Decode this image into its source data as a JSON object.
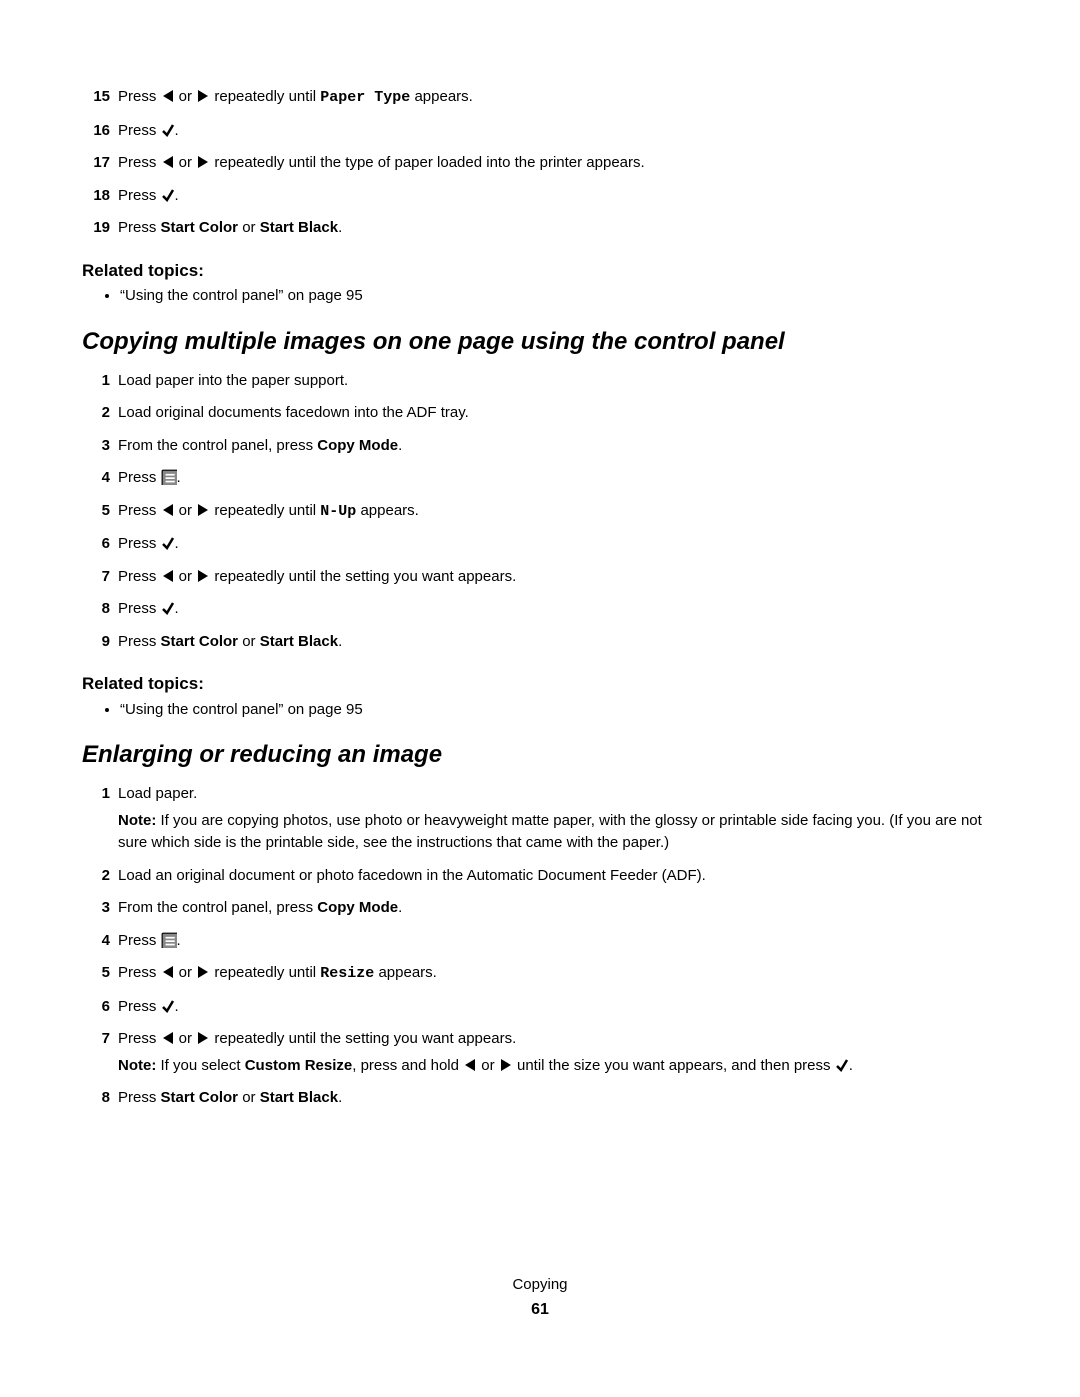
{
  "sectionA": {
    "steps": [
      {
        "n": "15",
        "parts": [
          {
            "t": "Press "
          },
          {
            "icon": "left"
          },
          {
            "t": " or "
          },
          {
            "icon": "right"
          },
          {
            "t": " repeatedly until "
          },
          {
            "t": "Paper Type",
            "cls": "mono"
          },
          {
            "t": " appears."
          }
        ]
      },
      {
        "n": "16",
        "parts": [
          {
            "t": "Press "
          },
          {
            "icon": "check"
          },
          {
            "t": "."
          }
        ]
      },
      {
        "n": "17",
        "parts": [
          {
            "t": "Press "
          },
          {
            "icon": "left"
          },
          {
            "t": " or "
          },
          {
            "icon": "right"
          },
          {
            "t": " repeatedly until the type of paper loaded into the printer appears."
          }
        ]
      },
      {
        "n": "18",
        "parts": [
          {
            "t": "Press "
          },
          {
            "icon": "check"
          },
          {
            "t": "."
          }
        ]
      },
      {
        "n": "19",
        "parts": [
          {
            "t": "Press "
          },
          {
            "t": "Start Color",
            "cls": "bold"
          },
          {
            "t": " or "
          },
          {
            "t": "Start Black",
            "cls": "bold"
          },
          {
            "t": "."
          }
        ]
      }
    ],
    "relatedHeading": "Related topics:",
    "relatedItem": "“Using the control panel” on page 95"
  },
  "sectionB": {
    "title": "Copying multiple images on one page using the control panel",
    "steps": [
      {
        "n": "1",
        "parts": [
          {
            "t": "Load paper into the paper support."
          }
        ]
      },
      {
        "n": "2",
        "parts": [
          {
            "t": "Load original documents facedown into the ADF tray."
          }
        ]
      },
      {
        "n": "3",
        "parts": [
          {
            "t": "From the control panel, press "
          },
          {
            "t": "Copy Mode",
            "cls": "bold"
          },
          {
            "t": "."
          }
        ]
      },
      {
        "n": "4",
        "parts": [
          {
            "t": "Press "
          },
          {
            "icon": "menu"
          },
          {
            "t": "."
          }
        ]
      },
      {
        "n": "5",
        "parts": [
          {
            "t": "Press "
          },
          {
            "icon": "left"
          },
          {
            "t": " or "
          },
          {
            "icon": "right"
          },
          {
            "t": " repeatedly until "
          },
          {
            "t": "N-Up",
            "cls": "mono"
          },
          {
            "t": " appears."
          }
        ]
      },
      {
        "n": "6",
        "parts": [
          {
            "t": "Press "
          },
          {
            "icon": "check"
          },
          {
            "t": "."
          }
        ]
      },
      {
        "n": "7",
        "parts": [
          {
            "t": "Press "
          },
          {
            "icon": "left"
          },
          {
            "t": " or "
          },
          {
            "icon": "right"
          },
          {
            "t": " repeatedly until the setting you want appears."
          }
        ]
      },
      {
        "n": "8",
        "parts": [
          {
            "t": "Press "
          },
          {
            "icon": "check"
          },
          {
            "t": "."
          }
        ]
      },
      {
        "n": "9",
        "parts": [
          {
            "t": "Press "
          },
          {
            "t": "Start Color",
            "cls": "bold"
          },
          {
            "t": " or "
          },
          {
            "t": "Start Black",
            "cls": "bold"
          },
          {
            "t": "."
          }
        ]
      }
    ],
    "relatedHeading": "Related topics:",
    "relatedItem": "“Using the control panel” on page 95"
  },
  "sectionC": {
    "title": "Enlarging or reducing an image",
    "steps": [
      {
        "n": "1",
        "parts": [
          {
            "t": "Load paper."
          }
        ],
        "extra": [
          [
            {
              "t": "Note:",
              "cls": "bold"
            },
            {
              "t": " If you are copying photos, use photo or heavyweight matte paper, with the glossy or printable side facing you. (If you are not sure which side is the printable side, see the instructions that came with the paper.)"
            }
          ]
        ]
      },
      {
        "n": "2",
        "parts": [
          {
            "t": "Load an original document or photo facedown in the Automatic Document Feeder (ADF)."
          }
        ]
      },
      {
        "n": "3",
        "parts": [
          {
            "t": "From the control panel, press "
          },
          {
            "t": "Copy Mode",
            "cls": "bold"
          },
          {
            "t": "."
          }
        ]
      },
      {
        "n": "4",
        "parts": [
          {
            "t": "Press "
          },
          {
            "icon": "menu"
          },
          {
            "t": "."
          }
        ]
      },
      {
        "n": "5",
        "parts": [
          {
            "t": "Press "
          },
          {
            "icon": "left"
          },
          {
            "t": " or "
          },
          {
            "icon": "right"
          },
          {
            "t": " repeatedly until "
          },
          {
            "t": "Resize",
            "cls": "mono"
          },
          {
            "t": " appears."
          }
        ]
      },
      {
        "n": "6",
        "parts": [
          {
            "t": "Press "
          },
          {
            "icon": "check"
          },
          {
            "t": "."
          }
        ]
      },
      {
        "n": "7",
        "parts": [
          {
            "t": "Press "
          },
          {
            "icon": "left"
          },
          {
            "t": " or "
          },
          {
            "icon": "right"
          },
          {
            "t": " repeatedly until the setting you want appears."
          }
        ],
        "extra": [
          [
            {
              "t": "Note:",
              "cls": "bold"
            },
            {
              "t": " If you select "
            },
            {
              "t": "Custom Resize",
              "cls": "bold"
            },
            {
              "t": ", press and hold "
            },
            {
              "icon": "left"
            },
            {
              "t": " or "
            },
            {
              "icon": "right"
            },
            {
              "t": " until the size you want appears, and then press "
            },
            {
              "icon": "check"
            },
            {
              "t": "."
            }
          ]
        ]
      },
      {
        "n": "8",
        "parts": [
          {
            "t": "Press "
          },
          {
            "t": "Start Color",
            "cls": "bold"
          },
          {
            "t": " or "
          },
          {
            "t": "Start Black",
            "cls": "bold"
          },
          {
            "t": "."
          }
        ]
      }
    ]
  },
  "footer": {
    "label": "Copying",
    "page": "61"
  }
}
